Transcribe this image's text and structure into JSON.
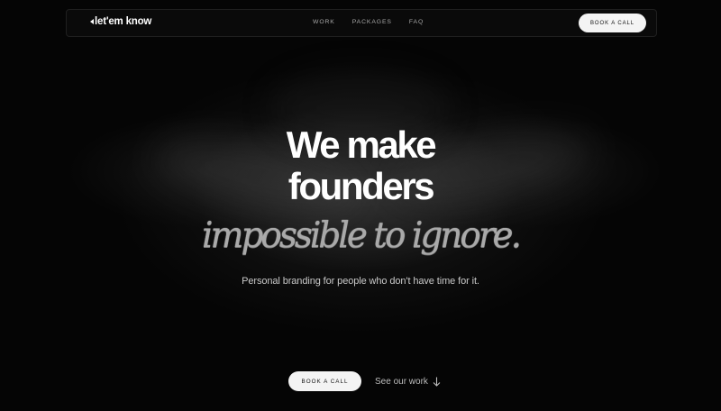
{
  "brand": {
    "logo_text": "let'em know"
  },
  "nav": {
    "links": [
      {
        "label": "WORK"
      },
      {
        "label": "PACKAGES"
      },
      {
        "label": "FAQ"
      }
    ],
    "cta_label": "BOOK A CALL"
  },
  "hero": {
    "headline_line1": "We make",
    "headline_line2": "founders",
    "headline_italic": "impossible to ignore.",
    "subtitle": "Personal branding for people who don't have time for it.",
    "primary_cta": "BOOK A CALL",
    "secondary_cta": "See our work",
    "secondary_icon": "arrow-down-icon"
  },
  "colors": {
    "background": "#050505",
    "text": "#ffffff",
    "button_bg": "#f4f4f4",
    "button_text": "#111111",
    "italic_text": "#a9a9a9"
  }
}
